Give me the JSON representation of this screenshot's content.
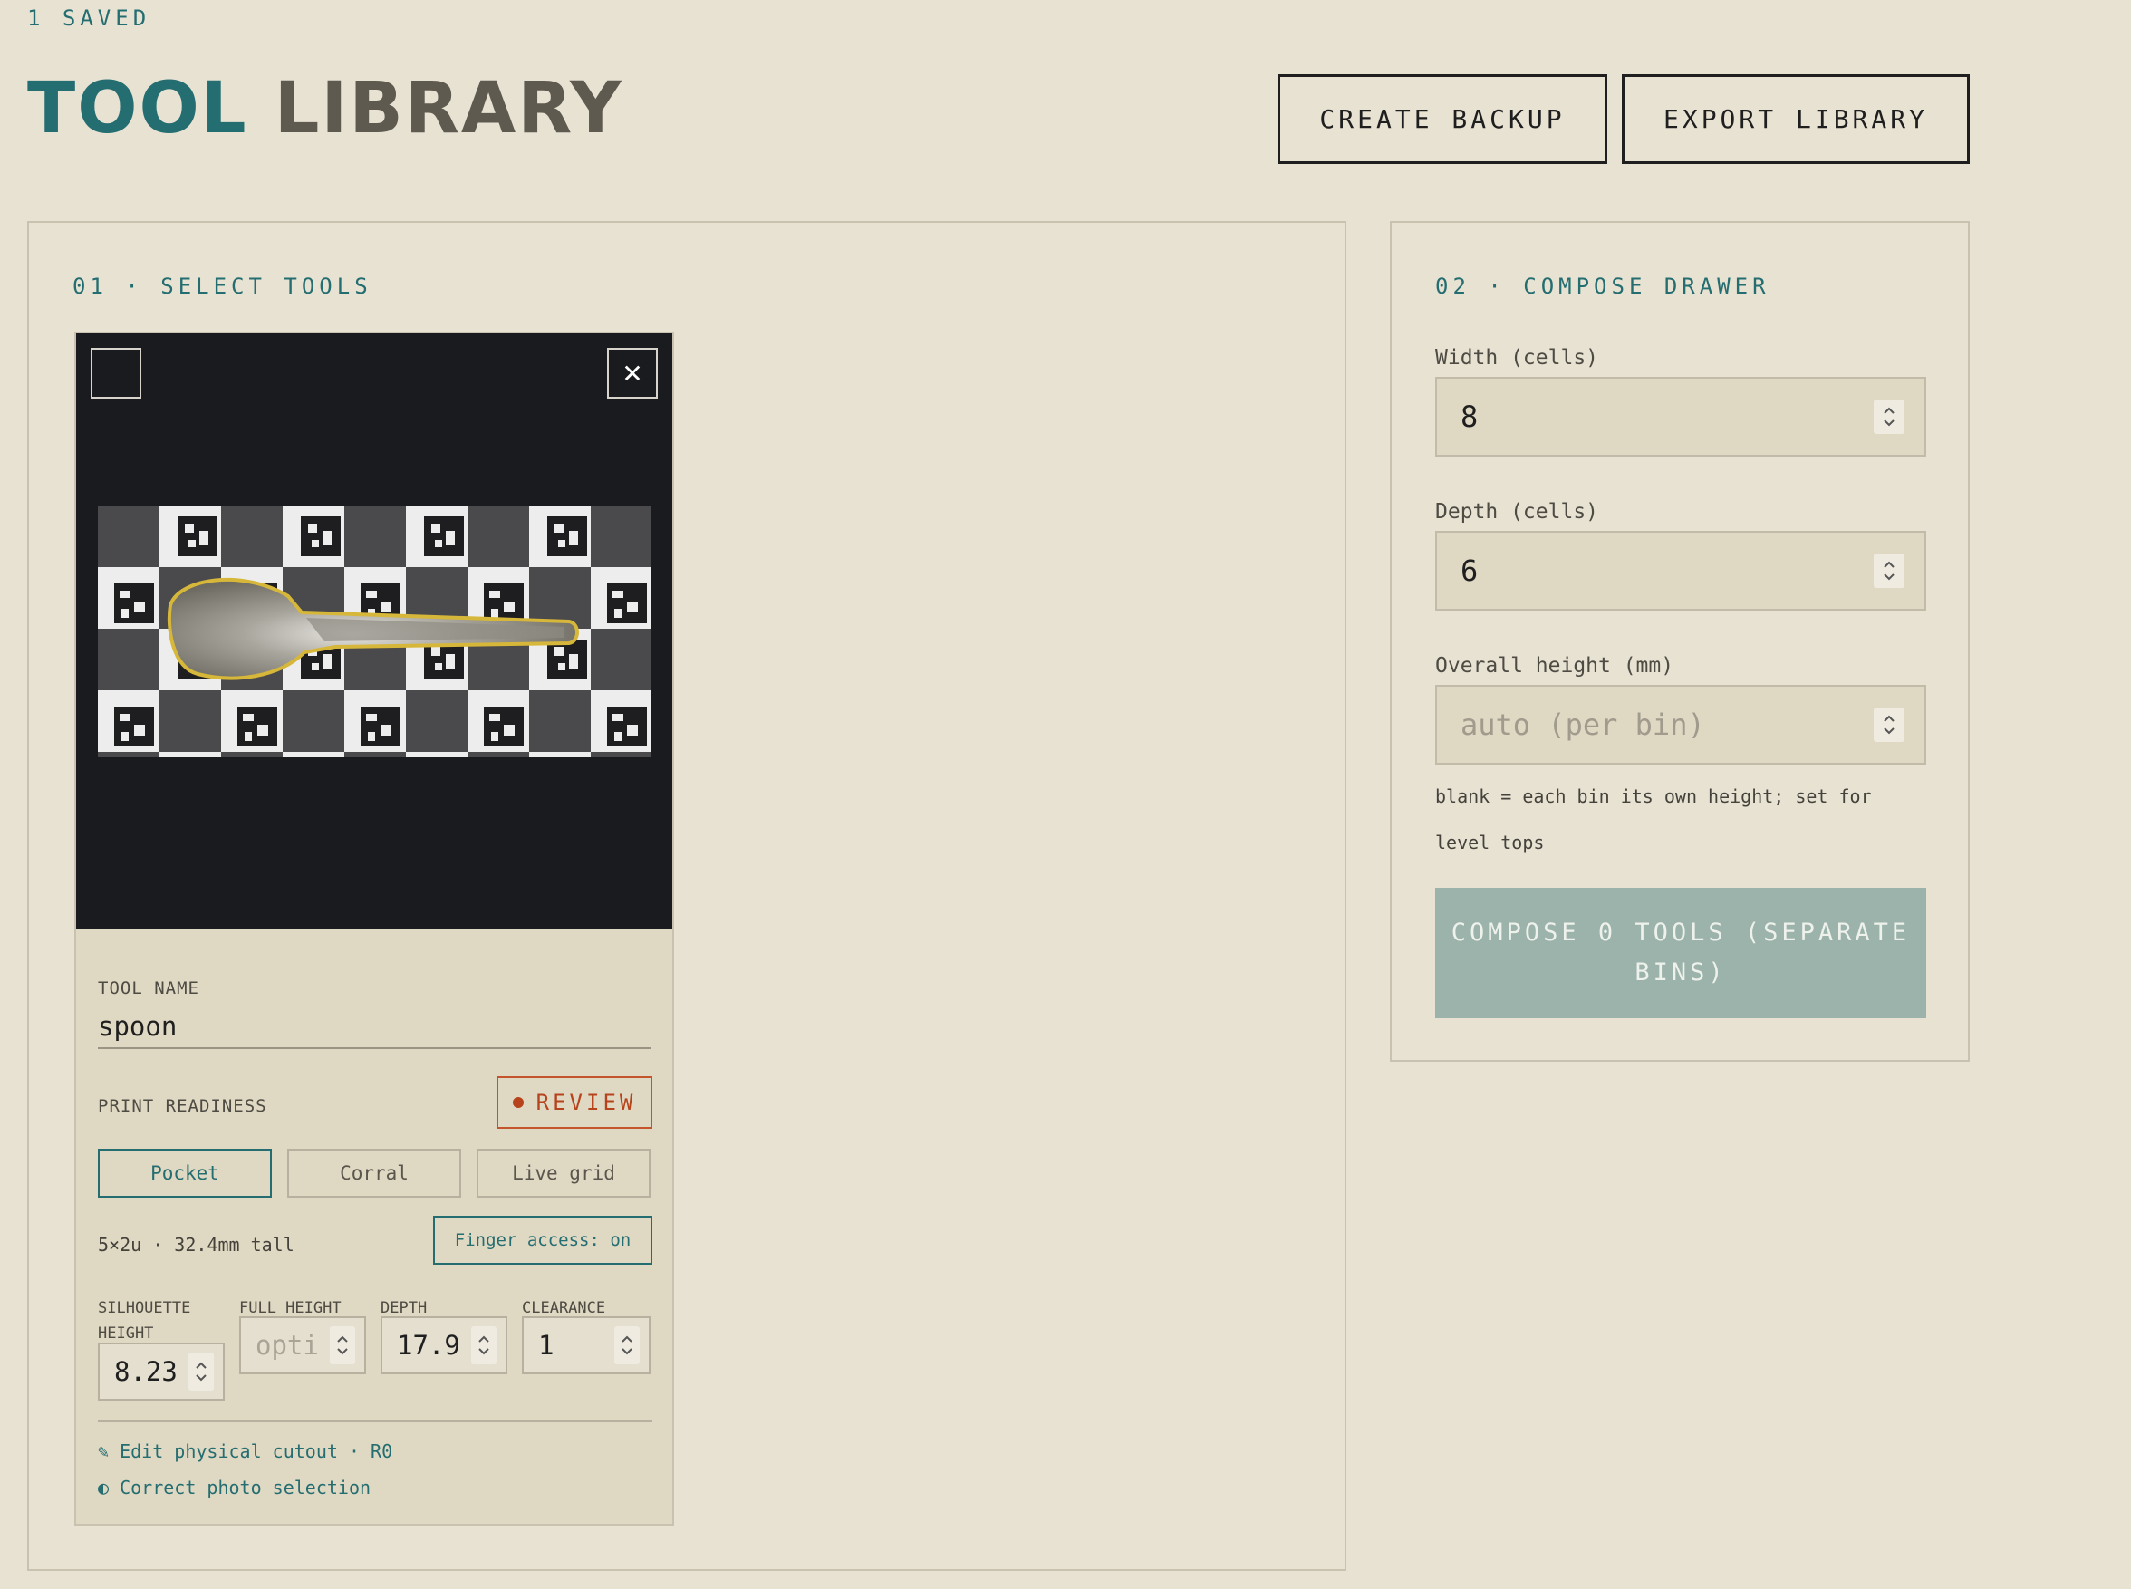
{
  "header": {
    "saved_status": "1 SAVED",
    "title_part1": "TOOL",
    "title_part2": "LIBRARY",
    "create_backup_label": "CREATE BACKUP",
    "export_library_label": "EXPORT LIBRARY"
  },
  "select_tools": {
    "section_title": "01 · SELECT TOOLS",
    "tool": {
      "remove_glyph": "✕",
      "name_label": "TOOL NAME",
      "name_value": "spoon",
      "readiness_label": "PRINT READINESS",
      "readiness_status": "REVIEW",
      "modes": [
        "Pocket",
        "Corral",
        "Live grid"
      ],
      "active_mode": "Pocket",
      "size_info": "5×2u · 32.4mm tall",
      "finger_access_label": "Finger access: on",
      "params": {
        "silhouette_height": {
          "label": "SILHOUETTE HEIGHT",
          "value": "8.23"
        },
        "full_height": {
          "label": "FULL HEIGHT",
          "placeholder": "opti"
        },
        "depth": {
          "label": "DEPTH",
          "value": "17.9"
        },
        "clearance": {
          "label": "CLEARANCE",
          "value": "1"
        }
      },
      "links": {
        "edit_cutout": "✎ Edit physical cutout · R0",
        "correct_photo": "◐ Correct photo selection"
      }
    }
  },
  "compose_drawer": {
    "section_title": "02 · COMPOSE DRAWER",
    "width_label": "Width (cells)",
    "width_value": "8",
    "depth_label": "Depth (cells)",
    "depth_value": "6",
    "height_label": "Overall height (mm)",
    "height_placeholder": "auto (per bin)",
    "height_hint": "blank = each bin its own height; set for level tops",
    "compose_button_label": "COMPOSE 0 TOOLS (SEPARATE BINS)"
  },
  "colors": {
    "accent_teal": "#246d70",
    "review_orange": "#b7431c",
    "background": "#e8e2d3",
    "compose_button": "#9bb3aa"
  }
}
